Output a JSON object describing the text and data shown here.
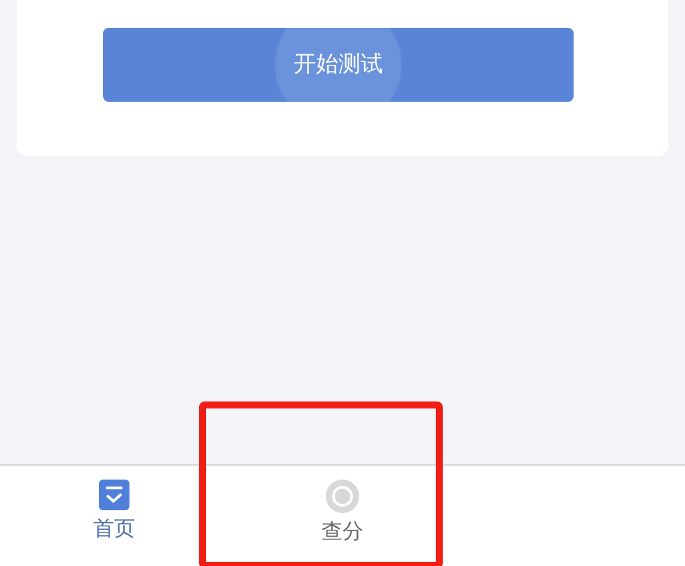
{
  "start_button": {
    "label": "开始测试"
  },
  "tab_bar": {
    "tabs": [
      {
        "label": "首页",
        "kind": "home",
        "selected": true,
        "highlighted": false
      },
      {
        "label": "查分",
        "kind": "search",
        "selected": false,
        "highlighted": true
      }
    ]
  }
}
